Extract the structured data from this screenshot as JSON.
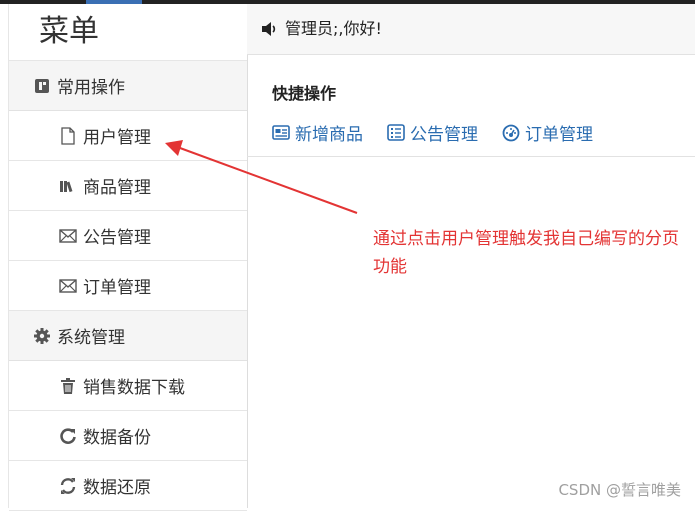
{
  "sidebar": {
    "title": "菜单",
    "groups": [
      {
        "label": "常用操作",
        "icon": "book-icon",
        "items": [
          {
            "label": "用户管理",
            "icon": "file-icon"
          },
          {
            "label": "商品管理",
            "icon": "books-icon"
          },
          {
            "label": "公告管理",
            "icon": "envelope-icon"
          },
          {
            "label": "订单管理",
            "icon": "envelope-icon"
          }
        ]
      },
      {
        "label": "系统管理",
        "icon": "gear-icon",
        "items": [
          {
            "label": "销售数据下载",
            "icon": "trash-icon"
          },
          {
            "label": "数据备份",
            "icon": "refresh-icon"
          },
          {
            "label": "数据还原",
            "icon": "sync-icon"
          }
        ]
      }
    ]
  },
  "header": {
    "greeting": "管理员;,你好!",
    "icon": "speaker-icon"
  },
  "quick": {
    "title": "快捷操作",
    "links": [
      {
        "label": "新增商品",
        "icon": "newspaper-icon"
      },
      {
        "label": "公告管理",
        "icon": "list-icon"
      },
      {
        "label": "订单管理",
        "icon": "dashboard-icon"
      }
    ]
  },
  "annotation": {
    "text": "通过点击用户管理触发我自己编写的分页功能",
    "color": "#e33434"
  },
  "watermark": "CSDN @誓言唯美",
  "colors": {
    "link": "#2a6cb0",
    "group_bg": "#f5f5f5",
    "topbar": "#222222",
    "accent": "#3a6fb4"
  }
}
